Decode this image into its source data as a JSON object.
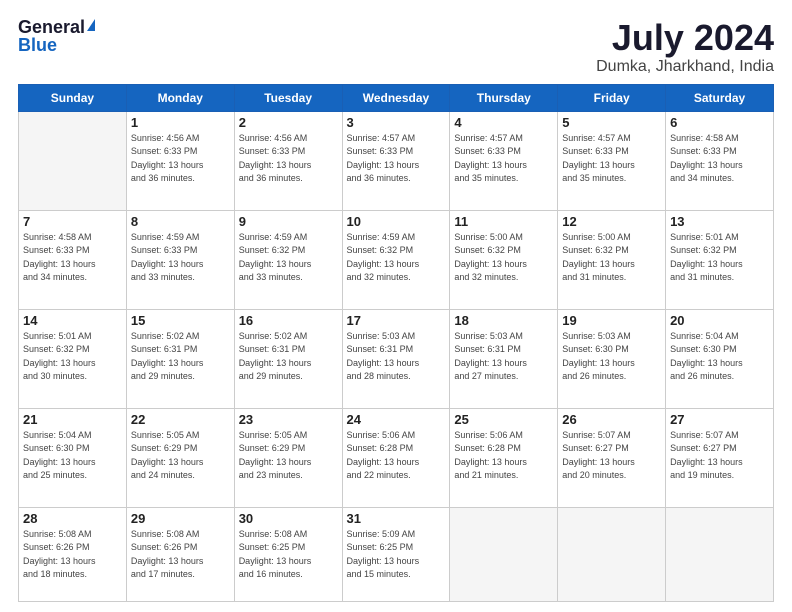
{
  "header": {
    "logo": {
      "general": "General",
      "blue": "Blue"
    },
    "title": "July 2024",
    "location": "Dumka, Jharkhand, India"
  },
  "calendar": {
    "days_of_week": [
      "Sunday",
      "Monday",
      "Tuesday",
      "Wednesday",
      "Thursday",
      "Friday",
      "Saturday"
    ],
    "weeks": [
      [
        {
          "day": "",
          "info": ""
        },
        {
          "day": "1",
          "info": "Sunrise: 4:56 AM\nSunset: 6:33 PM\nDaylight: 13 hours\nand 36 minutes."
        },
        {
          "day": "2",
          "info": "Sunrise: 4:56 AM\nSunset: 6:33 PM\nDaylight: 13 hours\nand 36 minutes."
        },
        {
          "day": "3",
          "info": "Sunrise: 4:57 AM\nSunset: 6:33 PM\nDaylight: 13 hours\nand 36 minutes."
        },
        {
          "day": "4",
          "info": "Sunrise: 4:57 AM\nSunset: 6:33 PM\nDaylight: 13 hours\nand 35 minutes."
        },
        {
          "day": "5",
          "info": "Sunrise: 4:57 AM\nSunset: 6:33 PM\nDaylight: 13 hours\nand 35 minutes."
        },
        {
          "day": "6",
          "info": "Sunrise: 4:58 AM\nSunset: 6:33 PM\nDaylight: 13 hours\nand 34 minutes."
        }
      ],
      [
        {
          "day": "7",
          "info": "Sunrise: 4:58 AM\nSunset: 6:33 PM\nDaylight: 13 hours\nand 34 minutes."
        },
        {
          "day": "8",
          "info": "Sunrise: 4:59 AM\nSunset: 6:33 PM\nDaylight: 13 hours\nand 33 minutes."
        },
        {
          "day": "9",
          "info": "Sunrise: 4:59 AM\nSunset: 6:32 PM\nDaylight: 13 hours\nand 33 minutes."
        },
        {
          "day": "10",
          "info": "Sunrise: 4:59 AM\nSunset: 6:32 PM\nDaylight: 13 hours\nand 32 minutes."
        },
        {
          "day": "11",
          "info": "Sunrise: 5:00 AM\nSunset: 6:32 PM\nDaylight: 13 hours\nand 32 minutes."
        },
        {
          "day": "12",
          "info": "Sunrise: 5:00 AM\nSunset: 6:32 PM\nDaylight: 13 hours\nand 31 minutes."
        },
        {
          "day": "13",
          "info": "Sunrise: 5:01 AM\nSunset: 6:32 PM\nDaylight: 13 hours\nand 31 minutes."
        }
      ],
      [
        {
          "day": "14",
          "info": "Sunrise: 5:01 AM\nSunset: 6:32 PM\nDaylight: 13 hours\nand 30 minutes."
        },
        {
          "day": "15",
          "info": "Sunrise: 5:02 AM\nSunset: 6:31 PM\nDaylight: 13 hours\nand 29 minutes."
        },
        {
          "day": "16",
          "info": "Sunrise: 5:02 AM\nSunset: 6:31 PM\nDaylight: 13 hours\nand 29 minutes."
        },
        {
          "day": "17",
          "info": "Sunrise: 5:03 AM\nSunset: 6:31 PM\nDaylight: 13 hours\nand 28 minutes."
        },
        {
          "day": "18",
          "info": "Sunrise: 5:03 AM\nSunset: 6:31 PM\nDaylight: 13 hours\nand 27 minutes."
        },
        {
          "day": "19",
          "info": "Sunrise: 5:03 AM\nSunset: 6:30 PM\nDaylight: 13 hours\nand 26 minutes."
        },
        {
          "day": "20",
          "info": "Sunrise: 5:04 AM\nSunset: 6:30 PM\nDaylight: 13 hours\nand 26 minutes."
        }
      ],
      [
        {
          "day": "21",
          "info": "Sunrise: 5:04 AM\nSunset: 6:30 PM\nDaylight: 13 hours\nand 25 minutes."
        },
        {
          "day": "22",
          "info": "Sunrise: 5:05 AM\nSunset: 6:29 PM\nDaylight: 13 hours\nand 24 minutes."
        },
        {
          "day": "23",
          "info": "Sunrise: 5:05 AM\nSunset: 6:29 PM\nDaylight: 13 hours\nand 23 minutes."
        },
        {
          "day": "24",
          "info": "Sunrise: 5:06 AM\nSunset: 6:28 PM\nDaylight: 13 hours\nand 22 minutes."
        },
        {
          "day": "25",
          "info": "Sunrise: 5:06 AM\nSunset: 6:28 PM\nDaylight: 13 hours\nand 21 minutes."
        },
        {
          "day": "26",
          "info": "Sunrise: 5:07 AM\nSunset: 6:27 PM\nDaylight: 13 hours\nand 20 minutes."
        },
        {
          "day": "27",
          "info": "Sunrise: 5:07 AM\nSunset: 6:27 PM\nDaylight: 13 hours\nand 19 minutes."
        }
      ],
      [
        {
          "day": "28",
          "info": "Sunrise: 5:08 AM\nSunset: 6:26 PM\nDaylight: 13 hours\nand 18 minutes."
        },
        {
          "day": "29",
          "info": "Sunrise: 5:08 AM\nSunset: 6:26 PM\nDaylight: 13 hours\nand 17 minutes."
        },
        {
          "day": "30",
          "info": "Sunrise: 5:08 AM\nSunset: 6:25 PM\nDaylight: 13 hours\nand 16 minutes."
        },
        {
          "day": "31",
          "info": "Sunrise: 5:09 AM\nSunset: 6:25 PM\nDaylight: 13 hours\nand 15 minutes."
        },
        {
          "day": "",
          "info": ""
        },
        {
          "day": "",
          "info": ""
        },
        {
          "day": "",
          "info": ""
        }
      ]
    ]
  }
}
